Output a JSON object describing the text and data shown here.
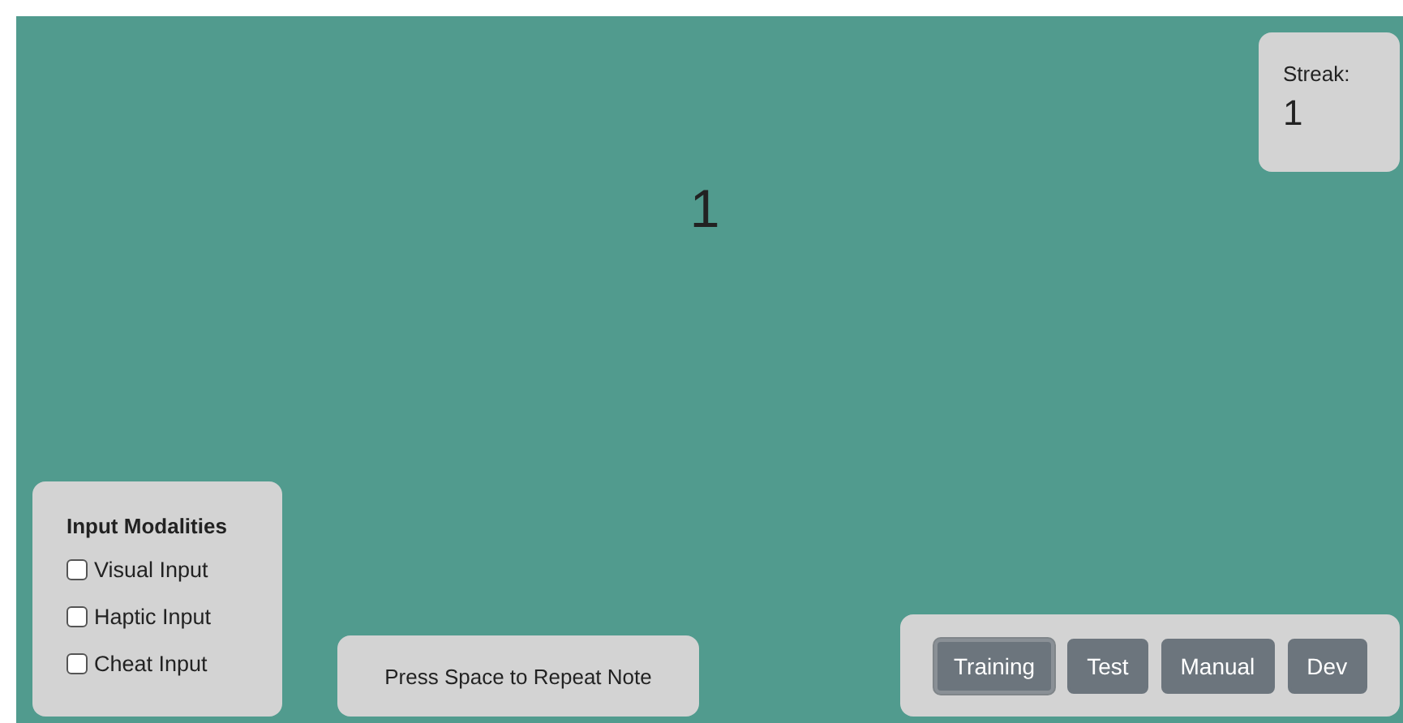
{
  "streak": {
    "label": "Streak:",
    "value": "1"
  },
  "note": "1",
  "modalities": {
    "title": "Input Modalities",
    "options": [
      {
        "label": "Visual Input",
        "checked": false
      },
      {
        "label": "Haptic Input",
        "checked": false
      },
      {
        "label": "Cheat Input",
        "checked": false
      }
    ]
  },
  "repeat_hint": "Press Space to Repeat Note",
  "modes": [
    {
      "label": "Training",
      "selected": true
    },
    {
      "label": "Test",
      "selected": false
    },
    {
      "label": "Manual",
      "selected": false
    },
    {
      "label": "Dev",
      "selected": false
    }
  ]
}
